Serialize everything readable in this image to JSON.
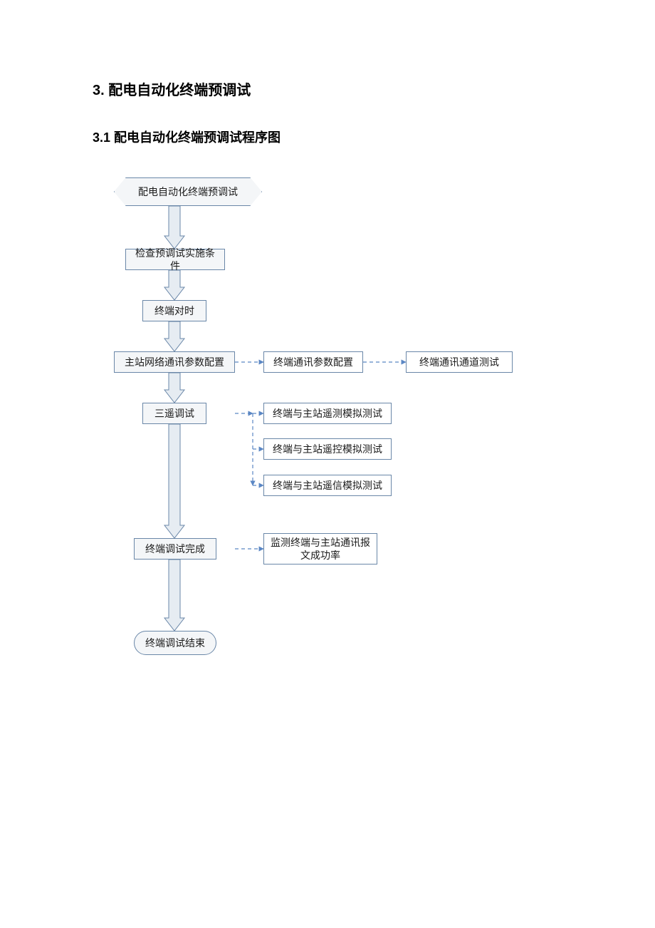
{
  "heading1": "3.  配电自动化终端预调试",
  "heading2": "3.1 配电自动化终端预调试程序图",
  "nodes": {
    "start": "配电自动化终端预调试",
    "check": "检查预调试实施条件",
    "sync": "终端对时",
    "master_net": "主站网络通讯参数配置",
    "term_param": "终端通讯参数配置",
    "term_chan": "终端通讯通道测试",
    "sanyao": "三遥调试",
    "yaoce": "终端与主站遥测模拟测试",
    "yaokong": "终端与主站遥控模拟测试",
    "yaoxin": "终端与主站遥信模拟测试",
    "done": "终端调试完成",
    "monitor": "监测终端与主站通讯报文成功率",
    "end": "终端调试结束"
  }
}
